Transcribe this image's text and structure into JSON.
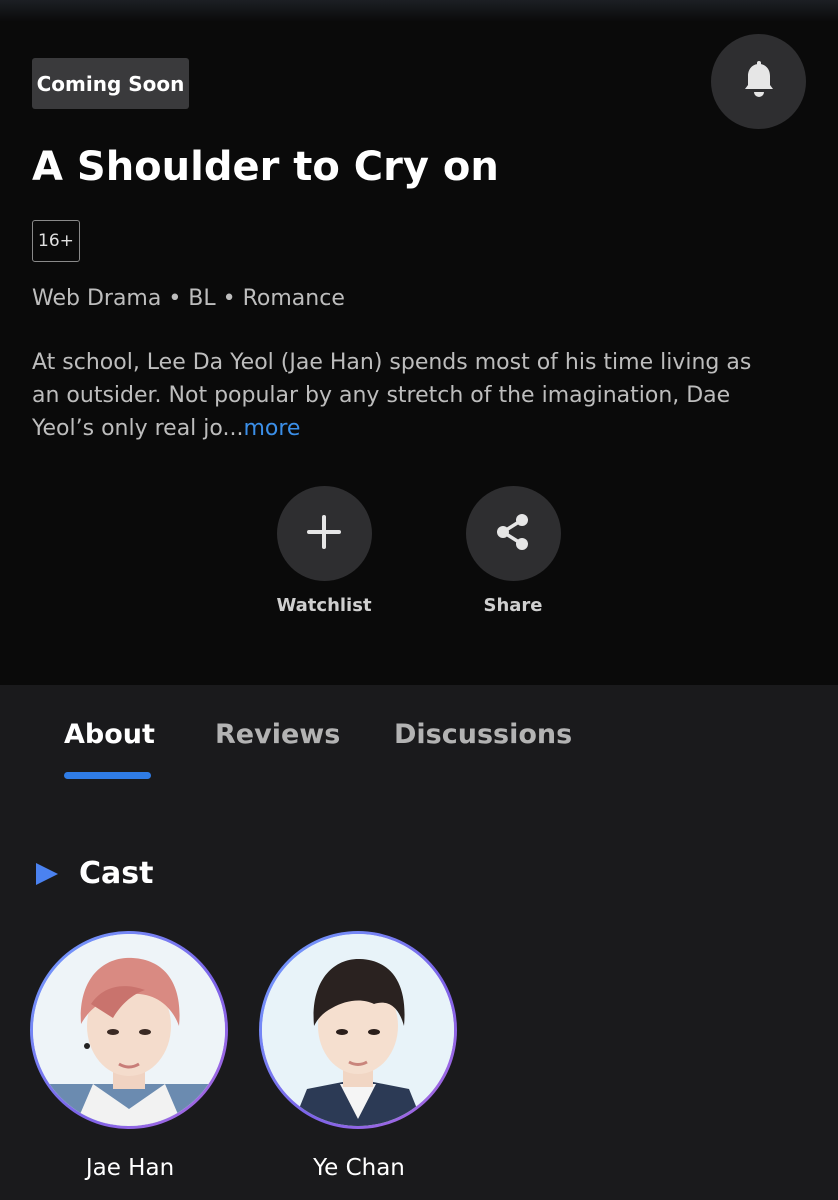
{
  "header": {
    "badge": "Coming Soon",
    "bell_icon": "bell-icon",
    "title": "A Shoulder to Cry on",
    "rating": "16+",
    "genres": "Web Drama • BL • Romance",
    "synopsis_lines": [
      "At school, Lee Da Yeol (Jae Han) spends most of his time living as",
      "an outsider. Not popular by any stretch of the imagination, Dae",
      "Yeol’s only real jo..."
    ],
    "more_label": "more"
  },
  "actions": {
    "watchlist": {
      "icon": "plus-icon",
      "label": "Watchlist"
    },
    "share": {
      "icon": "share-icon",
      "label": "Share"
    }
  },
  "tabs": [
    {
      "label": "About",
      "active": true
    },
    {
      "label": "Reviews",
      "active": false
    },
    {
      "label": "Discussions",
      "active": false
    }
  ],
  "cast_section": {
    "title": "Cast",
    "members": [
      {
        "name": "Jae Han"
      },
      {
        "name": "Ye Chan"
      }
    ]
  },
  "colors": {
    "accent": "#2f7ce6",
    "link": "#3b8fe8",
    "hero_bg": "#0a0a0a",
    "page_bg": "#1a1a1c"
  }
}
